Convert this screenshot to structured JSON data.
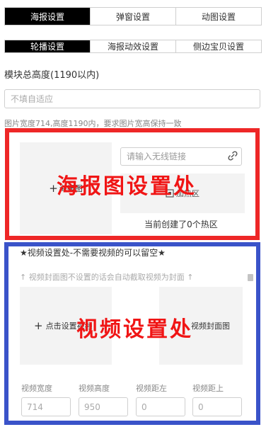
{
  "tabs": [
    {
      "label": "海报设置",
      "active": true
    },
    {
      "label": "弹窗设置",
      "active": false
    },
    {
      "label": "动图设置",
      "active": false
    }
  ],
  "subtabs": [
    {
      "label": "轮播设置",
      "active": true
    },
    {
      "label": "海报动效设置",
      "active": false
    },
    {
      "label": "侧边宝贝设置",
      "active": false
    }
  ],
  "module_height": {
    "label": "模块总高度(1190以内)",
    "placeholder": "不填自适应",
    "value": ""
  },
  "image_hint": "图片宽度714,高度1190内，要求图片宽高保持一致",
  "poster": {
    "upload_label": "海报图",
    "link_placeholder": "请输入无线链接",
    "hotspot_label": "加热区",
    "hotspot_count_text": "当前创建了0个热区",
    "overlay_text": "海报图设置处",
    "icons": [
      "plus-icon",
      "link-icon",
      "hotspot-icon",
      "arrow-up-icon"
    ]
  },
  "video": {
    "title": "★视频设置处-不需要视频的可以留空★",
    "hint": "↑ 视频封面图不设置的话会自动截取视频为封面 ↑",
    "upload_label": "点击设置视频",
    "cover_label": "视频封面图",
    "overlay_text": "视频设置处",
    "fields": [
      {
        "label": "视频宽度",
        "value": "714"
      },
      {
        "label": "视频高度",
        "value": "950"
      },
      {
        "label": "视频距左",
        "value": "0"
      },
      {
        "label": "视频距上",
        "value": "0"
      }
    ],
    "icons": [
      "plus-icon",
      "trash-icon",
      "arrow-down-icon"
    ]
  },
  "colors": {
    "active_tab_bg": "#000000",
    "poster_frame": "#ee2727",
    "video_frame": "#3a53c9",
    "overlay_text": "#f01515"
  }
}
